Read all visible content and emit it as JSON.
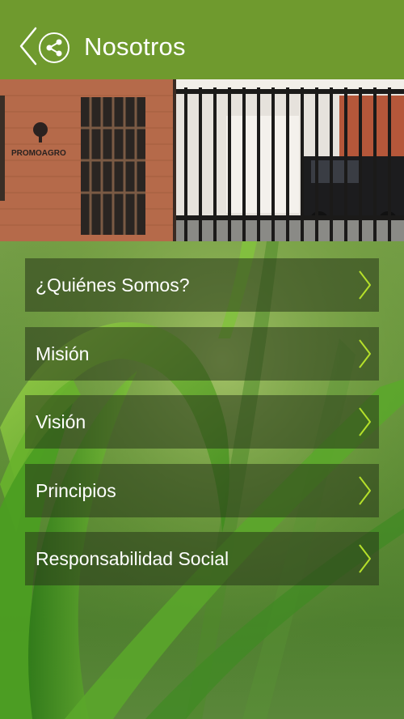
{
  "header": {
    "title": "Nosotros",
    "back_icon": "chevron-left-icon",
    "share_icon": "share-icon"
  },
  "banner": {
    "sign_text": "PROMOAGRO"
  },
  "menu": {
    "items": [
      {
        "label": "¿Quiénes Somos?"
      },
      {
        "label": "Misión"
      },
      {
        "label": "Visión"
      },
      {
        "label": "Principios"
      },
      {
        "label": "Responsabilidad Social"
      }
    ],
    "chevron_icon": "chevron-right-icon",
    "chevron_color": "#b5e02a"
  },
  "colors": {
    "header_bg": "#6f9a2e",
    "menu_item_bg": "rgba(40,55,25,0.55)",
    "text": "#ffffff"
  }
}
